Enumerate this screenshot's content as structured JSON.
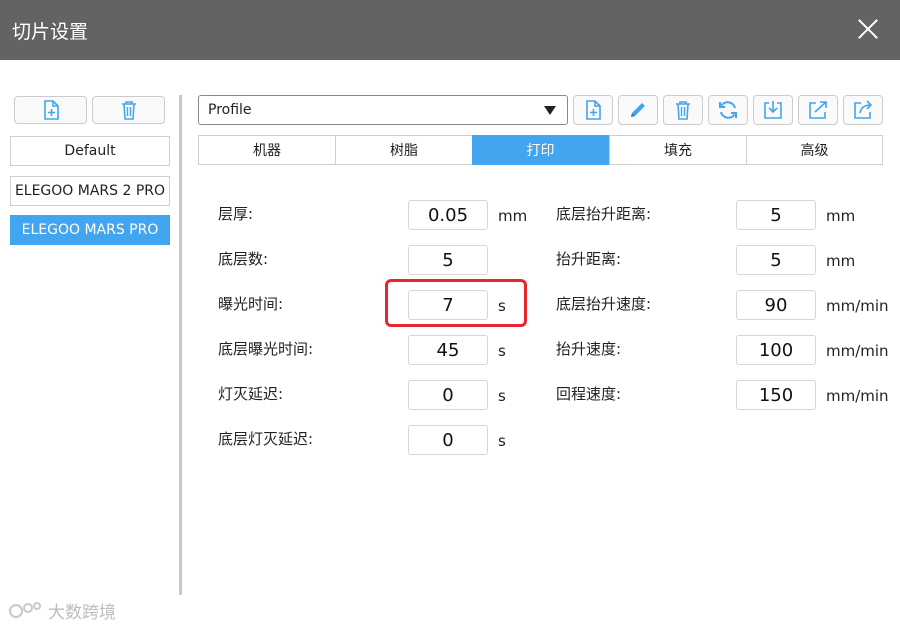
{
  "window": {
    "title": "切片设置"
  },
  "sidebar": {
    "profiles": [
      {
        "label": "Default",
        "selected": false
      },
      {
        "label": "ELEGOO MARS 2 PRO",
        "selected": false
      },
      {
        "label": "ELEGOO MARS PRO",
        "selected": true
      }
    ]
  },
  "toolbar": {
    "profile_select_value": "Profile",
    "icons": [
      "add-file-icon",
      "pencil-icon",
      "trash-icon",
      "refresh-icon",
      "import-icon",
      "export-icon",
      "share-icon"
    ]
  },
  "tabs": [
    {
      "label": "机器",
      "active": false
    },
    {
      "label": "树脂",
      "active": false
    },
    {
      "label": "打印",
      "active": true
    },
    {
      "label": "填充",
      "active": false
    },
    {
      "label": "高级",
      "active": false
    }
  ],
  "fields_left": [
    {
      "label": "层厚:",
      "value": "0.05",
      "unit": "mm"
    },
    {
      "label": "底层数:",
      "value": "5",
      "unit": ""
    },
    {
      "label": "曝光时间:",
      "value": "7",
      "unit": "s"
    },
    {
      "label": "底层曝光时间:",
      "value": "45",
      "unit": "s"
    },
    {
      "label": "灯灭延迟:",
      "value": "0",
      "unit": "s"
    },
    {
      "label": "底层灯灭延迟:",
      "value": "0",
      "unit": "s"
    }
  ],
  "fields_right": [
    {
      "label": "底层抬升距离:",
      "value": "5",
      "unit": "mm"
    },
    {
      "label": "抬升距离:",
      "value": "5",
      "unit": "mm"
    },
    {
      "label": "底层抬升速度:",
      "value": "90",
      "unit": "mm/min"
    },
    {
      "label": "抬升速度:",
      "value": "100",
      "unit": "mm/min"
    },
    {
      "label": "回程速度:",
      "value": "150",
      "unit": "mm/min"
    }
  ],
  "watermark": {
    "text": "大数跨境"
  },
  "colors": {
    "accent": "#42a5ef",
    "titlebar": "#636363",
    "highlight": "#e8262d"
  }
}
